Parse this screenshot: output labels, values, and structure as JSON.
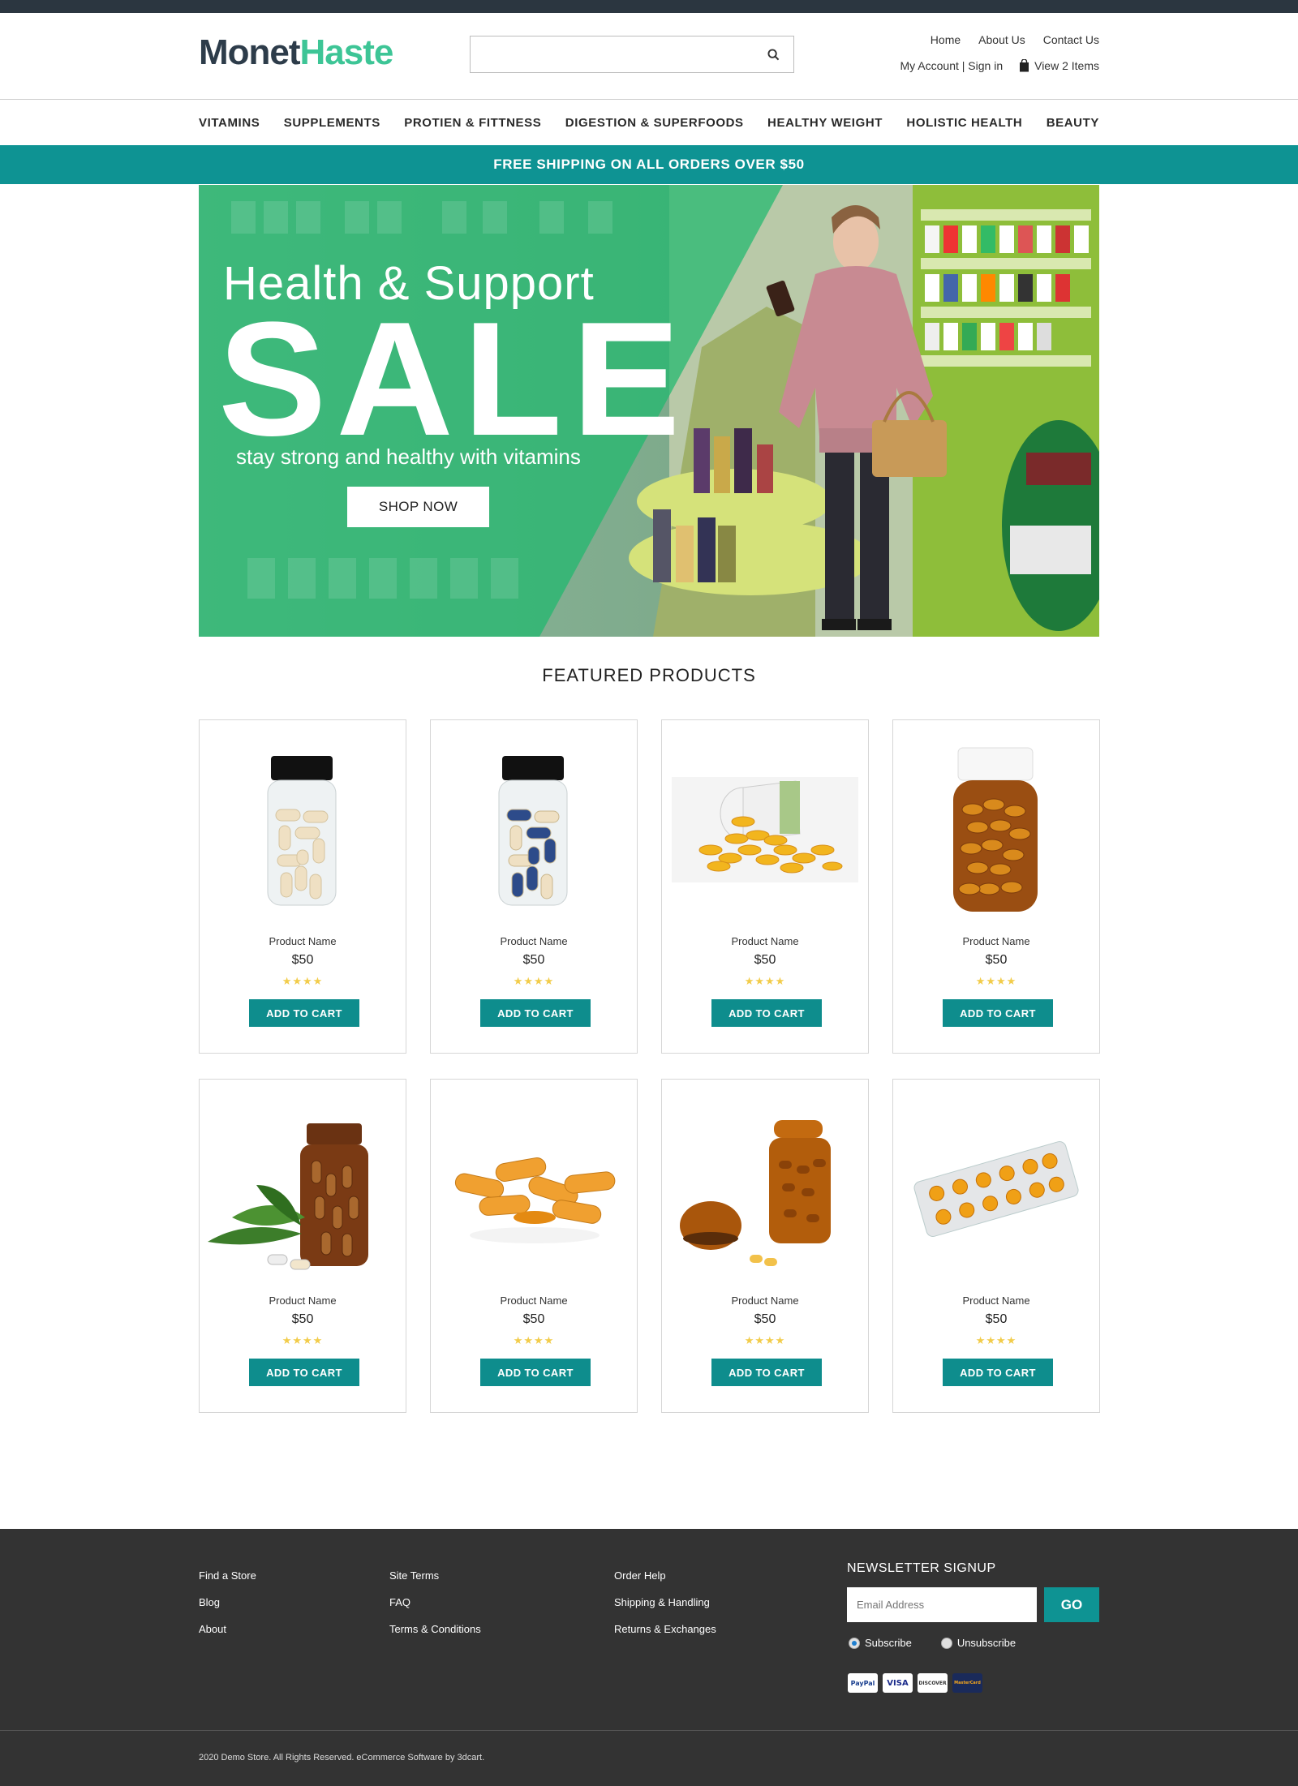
{
  "brand": {
    "part1": "Monet",
    "part2": "Haste"
  },
  "search": {
    "placeholder": "",
    "button_icon": "search-icon"
  },
  "toplinks": [
    "Home",
    "About Us",
    "Contact Us"
  ],
  "account": {
    "label": "My Account | Sign in"
  },
  "cart": {
    "label": "View 2 Items",
    "icon": "bag-icon"
  },
  "nav": [
    "VITAMINS",
    "SUPPLEMENTS",
    "PROTIEN & FITTNESS",
    "DIGESTION & SUPERFOODS",
    "HEALTHY WEIGHT",
    "HOLISTIC HEALTH",
    "BEAUTY"
  ],
  "promo": "FREE SHIPPING ON ALL ORDERS OVER $50",
  "hero": {
    "line1": "Health & Support",
    "line2": "SALE",
    "line3": "stay strong and healthy with vitamins",
    "button": "SHOP NOW"
  },
  "featured_title": "FEATURED PRODUCTS",
  "products": [
    {
      "name": "Product Name",
      "price": "$50",
      "stars": "★★★★",
      "button": "ADD TO CART",
      "image": "white-capsule-jar"
    },
    {
      "name": "Product Name",
      "price": "$50",
      "stars": "★★★★",
      "button": "ADD TO CART",
      "image": "blue-capsule-jar"
    },
    {
      "name": "Product Name",
      "price": "$50",
      "stars": "★★★★",
      "button": "ADD TO CART",
      "image": "spilled-softgels"
    },
    {
      "name": "Product Name",
      "price": "$50",
      "stars": "★★★★",
      "button": "ADD TO CART",
      "image": "amber-softgel-bottle"
    },
    {
      "name": "Product Name",
      "price": "$50",
      "stars": "★★★★",
      "button": "ADD TO CART",
      "image": "amber-bottle-leaves"
    },
    {
      "name": "Product Name",
      "price": "$50",
      "stars": "★★★★",
      "button": "ADD TO CART",
      "image": "orange-capsules"
    },
    {
      "name": "Product Name",
      "price": "$50",
      "stars": "★★★★",
      "button": "ADD TO CART",
      "image": "amber-jar-open"
    },
    {
      "name": "Product Name",
      "price": "$50",
      "stars": "★★★★",
      "button": "ADD TO CART",
      "image": "blister-pack"
    }
  ],
  "footer": {
    "col1": [
      "Find a Store",
      "Blog",
      "About"
    ],
    "col2": [
      "Site Terms",
      "FAQ",
      "Terms & Conditions"
    ],
    "col3": [
      "Order Help",
      "Shipping & Handling",
      "Returns & Exchanges"
    ],
    "newsletter_title": "NEWSLETTER SIGNUP",
    "email_placeholder": "Email Address",
    "go": "GO",
    "subscribe": "Subscribe",
    "unsubscribe": "Unsubscribe",
    "payment_cards": [
      "PayPal",
      "VISA",
      "DISCOVER",
      "MasterCard"
    ],
    "copyright": "2020  Demo Store. All Rights Reserved. eCommerce Software by 3dcart."
  },
  "colors": {
    "teal": "#0e9393",
    "logo_dark": "#2d3c4a",
    "logo_green": "#3dc596",
    "footer_bg": "#333333",
    "star": "#f2cc4a"
  }
}
